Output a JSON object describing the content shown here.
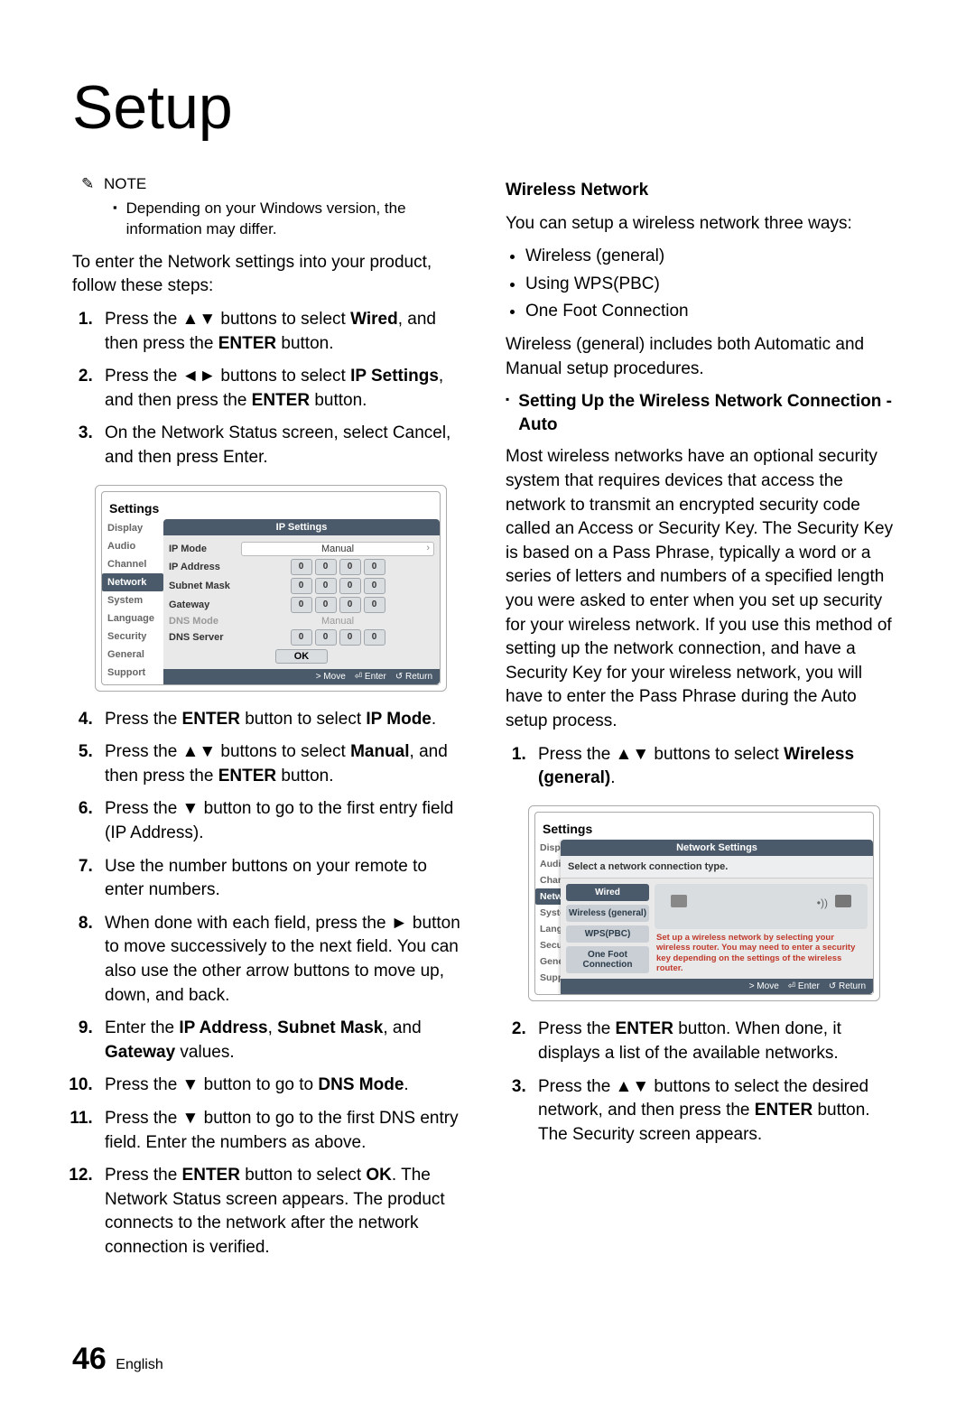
{
  "title": "Setup",
  "note_label": "NOTE",
  "note_bullet": "Depending on your Windows version, the information may differ.",
  "intro": "To enter the Network settings into your product, follow these steps:",
  "steps_a": [
    "Press the ▲▼ buttons to select <b>Wired</b>, and then press the <b>ENTER</b> button.",
    "Press the ◄► buttons to select <b>IP Settings</b>, and then press the <b>ENTER</b> button.",
    "On the Network Status screen, select Cancel, and then press Enter."
  ],
  "shot1": {
    "title": "Settings",
    "sidebar": [
      "Display",
      "Audio",
      "Channel",
      "Network",
      "System",
      "Language",
      "Security",
      "General",
      "Support"
    ],
    "sidebar_active": 3,
    "pane_header": "IP Settings",
    "rows": [
      {
        "label": "IP Mode",
        "type": "select",
        "value": "Manual"
      },
      {
        "label": "IP Address",
        "type": "ip",
        "values": [
          "0",
          "0",
          "0",
          "0"
        ]
      },
      {
        "label": "Subnet Mask",
        "type": "ip",
        "values": [
          "0",
          "0",
          "0",
          "0"
        ]
      },
      {
        "label": "Gateway",
        "type": "ip",
        "values": [
          "0",
          "0",
          "0",
          "0"
        ]
      },
      {
        "label": "DNS Mode",
        "type": "text",
        "value": "Manual",
        "disabled": true
      },
      {
        "label": "DNS Server",
        "type": "ip",
        "values": [
          "0",
          "0",
          "0",
          "0"
        ]
      }
    ],
    "ok": "OK",
    "footer": [
      "> Move",
      "⏎ Enter",
      "↺ Return"
    ]
  },
  "steps_b": [
    "Press the <b>ENTER</b> button to select <b>IP Mode</b>.",
    "Press the ▲▼ buttons to select <b>Manual</b>, and then press the <b>ENTER</b> button.",
    "Press the ▼ button to go to the first entry field (IP Address).",
    "Use the number buttons on your remote to enter numbers.",
    "When done with each field, press the ► button to move successively to the next field. You can also use the other arrow buttons to move up, down, and back.",
    "Enter the <b>IP Address</b>, <b>Subnet Mask</b>, and <b>Gateway</b> values.",
    "Press the ▼ button to go to <b>DNS Mode</b>.",
    "Press the ▼ button to go to the first DNS entry field. Enter the numbers as above.",
    "Press the <b>ENTER</b> button to select <b>OK</b>. The Network Status screen appears. The product connects to the network after the network connection is verified."
  ],
  "right": {
    "heading": "Wireless Network",
    "intro": "You can setup a wireless network three ways:",
    "bullets": [
      "Wireless (general)",
      "Using WPS(PBC)",
      "One Foot Connection"
    ],
    "after_bullets": "Wireless (general) includes both Automatic and Manual setup procedures.",
    "sub_heading": "Setting Up the Wireless Network Connection - Auto",
    "para": "Most wireless networks have an optional security system that requires devices that access the network to transmit an encrypted security code called an Access or Security Key. The Security Key is based on a Pass Phrase, typically a word or a series of letters and numbers of a specified length you were asked to enter when you set up security for your wireless network. If you use this method of setting up the network connection, and have a Security Key for your wireless network, you will have to enter the Pass Phrase during the Auto setup process.",
    "steps_r1": [
      "Press the ▲▼ buttons to select <b>Wireless (general)</b>."
    ],
    "shot2": {
      "title": "Settings",
      "sidebar": [
        "Displ",
        "Audi",
        "Chan",
        "Netw",
        "Syste",
        "Lang",
        "Secu",
        "Gene",
        "Supp"
      ],
      "sidebar_active": 3,
      "pane_header": "Network Settings",
      "desc": "Select a network connection type.",
      "conns": [
        "Wired",
        "Wireless (general)",
        "WPS(PBC)",
        "One Foot Connection"
      ],
      "conn_sel": 0,
      "conn_desc": "Set up a wireless network by selecting your wireless router. You may need to enter a security key depending on the settings of the wireless router.",
      "footer": [
        "> Move",
        "⏎ Enter",
        "↺ Return"
      ]
    },
    "steps_r2": [
      "Press the <b>ENTER</b> button. When done, it displays a list of the available networks.",
      "Press the ▲▼ buttons to select the desired network, and then press the <b>ENTER</b> button. The Security screen appears."
    ]
  },
  "footer": {
    "page": "46",
    "lang": "English"
  }
}
